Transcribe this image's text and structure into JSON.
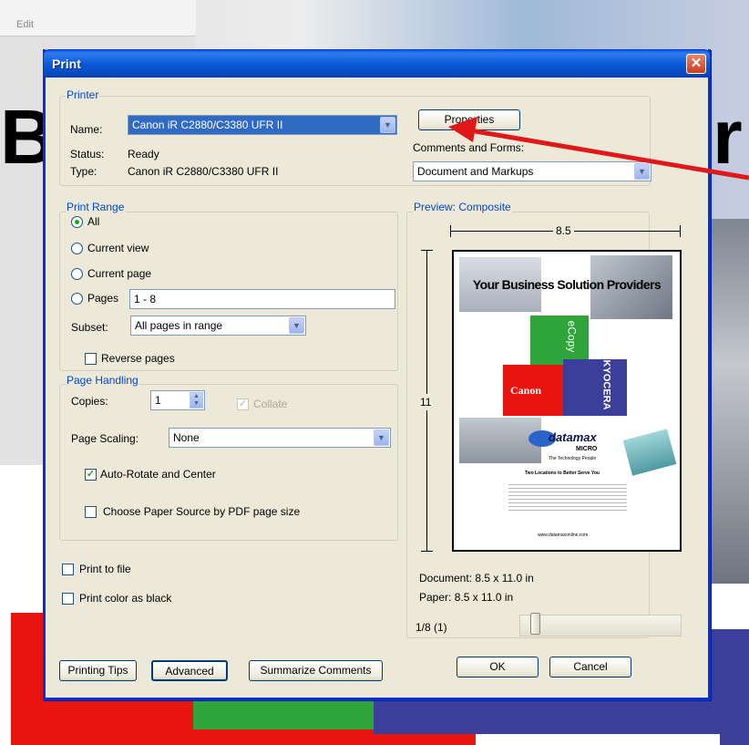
{
  "window": {
    "title": "Print",
    "close_glyph": "✕"
  },
  "printer": {
    "group_label": "Printer",
    "name_label": "Name:",
    "name_value": "Canon iR C2880/C3380 UFR II",
    "status_label": "Status:",
    "status_value": "Ready",
    "type_label": "Type:",
    "type_value": "Canon iR C2880/C3380 UFR II",
    "properties_label": "Properties",
    "comments_label": "Comments and Forms:",
    "comments_value": "Document and Markups"
  },
  "print_range": {
    "group_label": "Print Range",
    "all_label": "All",
    "current_view_label": "Current view",
    "current_page_label": "Current page",
    "pages_label": "Pages",
    "pages_value": "1 - 8",
    "subset_label": "Subset:",
    "subset_value": "All pages in range",
    "reverse_label": "Reverse pages",
    "selected": "All"
  },
  "page_handling": {
    "group_label": "Page Handling",
    "copies_label": "Copies:",
    "copies_value": "1",
    "collate_label": "Collate",
    "scaling_label": "Page Scaling:",
    "scaling_value": "None",
    "auto_rotate_label": "Auto-Rotate and Center",
    "auto_rotate_checked": true,
    "paper_source_label": "Choose Paper Source by PDF page size",
    "paper_source_checked": false
  },
  "options": {
    "print_to_file_label": "Print to file",
    "print_color_black_label": "Print color as black"
  },
  "preview": {
    "group_label": "Preview: Composite",
    "width_label": "8.5",
    "height_label": "11",
    "document_size": "Document: 8.5 x 11.0 in",
    "paper_size": "Paper: 8.5 x 11.0 in",
    "page_indicator": "1/8 (1)",
    "slider_position": 0.05,
    "page_content": {
      "headline": "Your Business Solution Providers",
      "ecopy": "eCopy",
      "canon": "Canon",
      "kyocera": "KYOCERA",
      "datamax": "datamax",
      "micro": "MICRO",
      "tagline": "The Technology People",
      "locations": "Two Locations to Better Serve You",
      "website": "www.datamaxonline.com"
    }
  },
  "buttons": {
    "printing_tips": "Printing Tips",
    "advanced": "Advanced",
    "summarize": "Summarize Comments",
    "ok": "OK",
    "cancel": "Cancel"
  },
  "background": {
    "partial_text_left": "Bu",
    "partial_text_right": "r",
    "menu_fragment": "Edit",
    "colors": {
      "red": "#e8140e",
      "green": "#2ea43a",
      "blue": "#3b3f9a",
      "arrow": "#e01818"
    }
  }
}
